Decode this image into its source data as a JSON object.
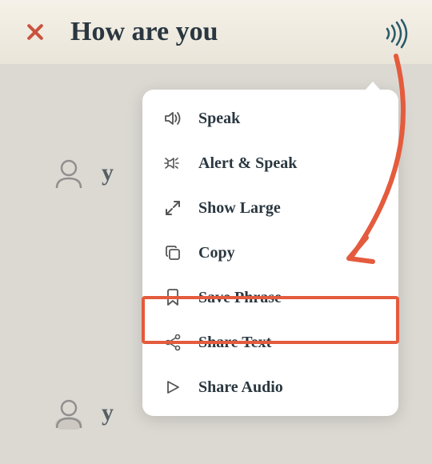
{
  "header": {
    "title": "How are you"
  },
  "background": {
    "item1": "y",
    "item2": "y"
  },
  "menu": {
    "items": [
      {
        "label": "Speak"
      },
      {
        "label": "Alert & Speak"
      },
      {
        "label": "Show Large"
      },
      {
        "label": "Copy"
      },
      {
        "label": "Save Phrase"
      },
      {
        "label": "Share Text"
      },
      {
        "label": "Share Audio"
      }
    ]
  },
  "highlight": {
    "color": "#e45b3d"
  }
}
